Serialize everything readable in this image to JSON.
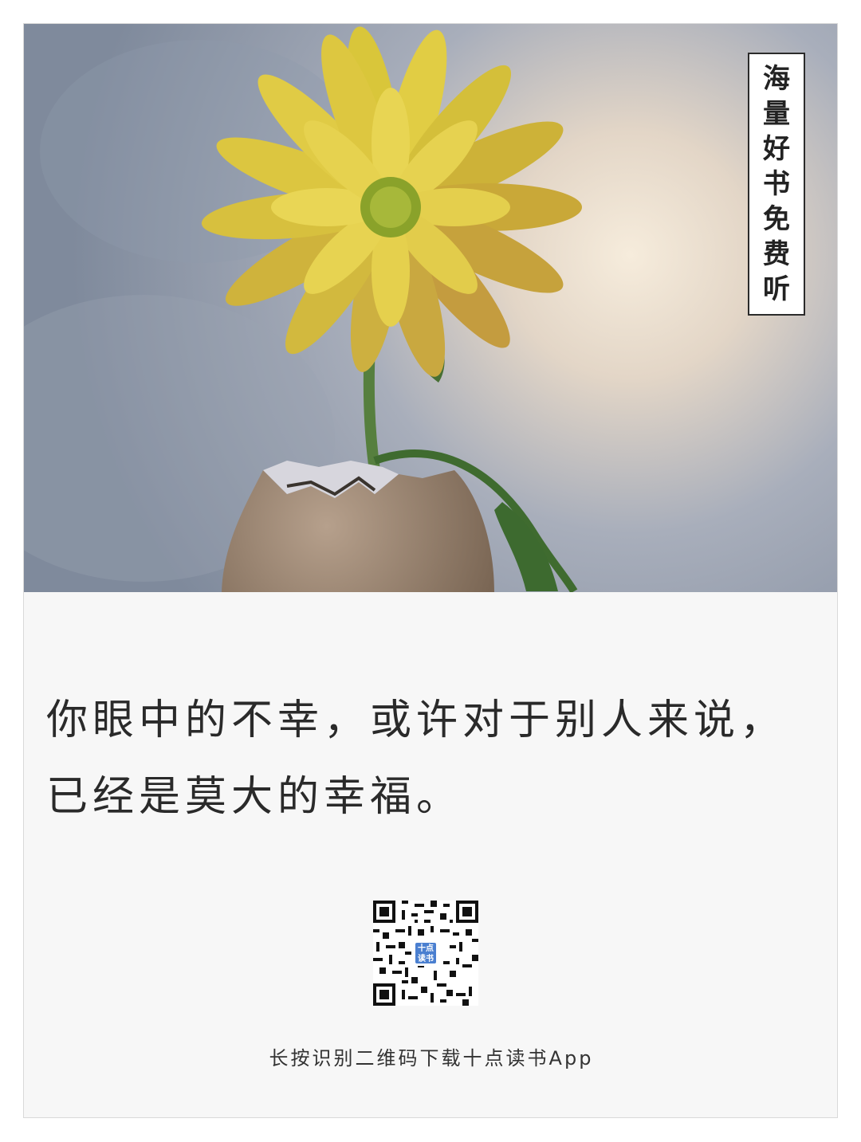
{
  "poster": {
    "side_tag": [
      "海",
      "量",
      "好",
      "书",
      "免",
      "费",
      "听"
    ],
    "quote_lines": [
      "你眼中的不幸，或许对于别人来说，",
      "已经是莫大的幸福。"
    ],
    "qr_logo_text": "十点读书",
    "caption": "长按识别二维码下载十点读书App"
  },
  "icons": {
    "qr": "qr-code-icon",
    "logo": "app-logo-icon"
  },
  "colors": {
    "sky_blue": "#8c97a8",
    "glow": "#f3e8d6",
    "petal": "#d9c43a",
    "stem": "#4f7a3a",
    "shell": "#a08b78",
    "text": "#2a2a2a"
  }
}
